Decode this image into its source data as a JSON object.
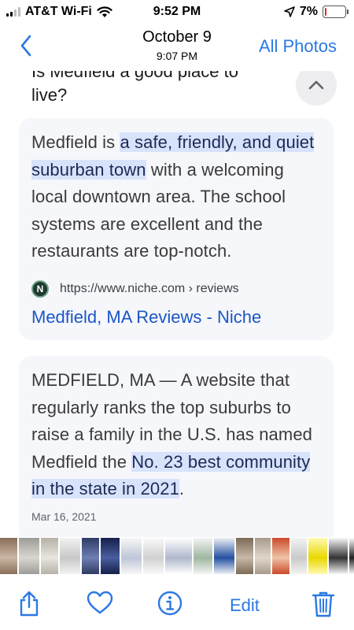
{
  "status_bar": {
    "carrier": "AT&T Wi-Fi",
    "time": "9:52 PM",
    "battery": "7%",
    "battery_level": 0.07,
    "icons": [
      "signal-icon",
      "wifi-icon",
      "location-arrow-icon",
      "battery-icon"
    ]
  },
  "nav": {
    "back_icon": "chevron-left-icon",
    "date": "October 9",
    "time": "9:07 PM",
    "all_photos": "All Photos"
  },
  "screenshot_content": {
    "question": "Is Medfield a good place to live?",
    "collapse_icon": "chevron-up-icon",
    "result1": {
      "text_before": "Medfield is ",
      "highlight": "a safe, friendly, and quiet suburban town",
      "text_after": " with a welcoming local downtown area. The school systems are excellent and the restaurants are top-notch.",
      "favicon_letter": "N",
      "source_url": "https://www.niche.com › reviews",
      "link_title": "Medfield, MA Reviews - Niche"
    },
    "result2": {
      "text_before": "MEDFIELD, MA — A website that regularly ranks the top suburbs to raise a family in the U.S. has named Medfield the ",
      "highlight": "No. 23 best community in the state in 2021",
      "text_after": ".",
      "date": "Mar 16, 2021"
    }
  },
  "thumbnails": [
    {
      "bg": "#8a6e5a",
      "accent": "#c9b6a3",
      "w": 22
    },
    {
      "bg": "#9c9c96",
      "accent": "#d9d6cf",
      "w": 26
    },
    {
      "bg": "#b7b2a6",
      "accent": "#e8e5de",
      "w": 22
    },
    {
      "bg": "#f2f2f2",
      "accent": "#c8c8c8",
      "w": 26
    },
    {
      "bg": "#2f3b63",
      "accent": "#6d7fb5",
      "w": 22
    },
    {
      "bg": "#14204a",
      "accent": "#4a5ea0",
      "w": 24
    },
    {
      "bg": "#f7f7f7",
      "accent": "#bfc6d8",
      "w": 26
    },
    {
      "bg": "#fafafa",
      "accent": "#d0d0d0",
      "w": 26
    },
    {
      "bg": "#ffffff",
      "accent": "#b0b8cc",
      "w": 34
    },
    {
      "bg": "#f4f4f4",
      "accent": "#9fb7a0",
      "w": 24
    },
    {
      "bg": "#eef0f4",
      "accent": "#2450a0",
      "w": 26
    },
    {
      "bg": "#7c6a55",
      "accent": "#c7b9a8",
      "w": 22
    },
    {
      "bg": "#a79a8b",
      "accent": "#e0d7cb",
      "w": 20
    },
    {
      "bg": "#c94a2a",
      "accent": "#f0c3a8",
      "w": 22
    },
    {
      "bg": "#f3f3f3",
      "accent": "#c9c9c9",
      "w": 20
    },
    {
      "bg": "#fff9b0",
      "accent": "#e8d800",
      "w": 24
    },
    {
      "bg": "#f7f7f7",
      "accent": "#333333",
      "w": 24
    },
    {
      "bg": "#fbfbfb",
      "accent": "#222222",
      "w": 22
    },
    {
      "bg": "#4a5566",
      "accent": "#c0a58a",
      "w": 26
    }
  ],
  "toolbar": {
    "share_icon": "share-icon",
    "favorite_icon": "heart-icon",
    "info_icon": "info-icon",
    "edit": "Edit",
    "delete_icon": "trash-icon"
  },
  "colors": {
    "accent": "#2b78e4",
    "highlight": "#d8e3fb",
    "link": "#1a56c4",
    "card_bg": "#f6f7fb",
    "battery_low": "#e02424"
  }
}
